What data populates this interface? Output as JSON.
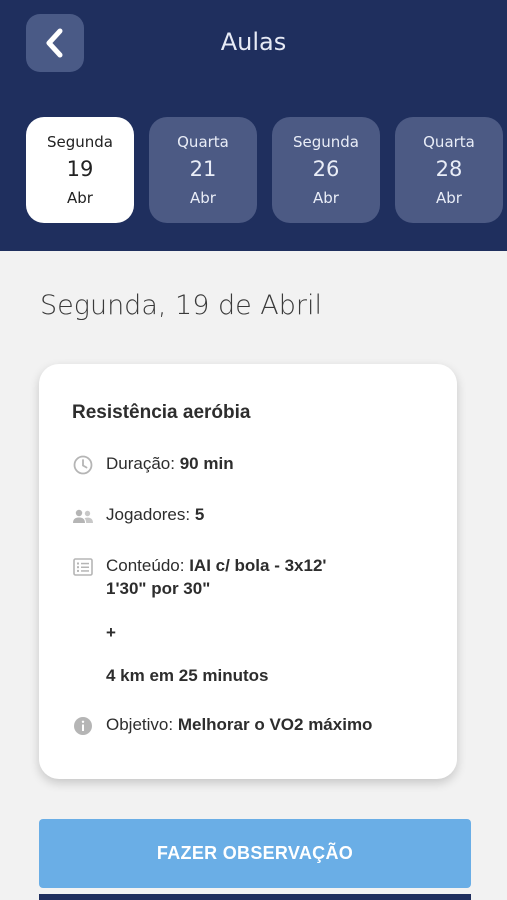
{
  "header": {
    "title": "Aulas"
  },
  "dates": [
    {
      "dow": "Segunda",
      "day": "19",
      "month": "Abr",
      "selected": true
    },
    {
      "dow": "Quarta",
      "day": "21",
      "month": "Abr",
      "selected": false
    },
    {
      "dow": "Segunda",
      "day": "26",
      "month": "Abr",
      "selected": false
    },
    {
      "dow": "Quarta",
      "day": "28",
      "month": "Abr",
      "selected": false
    }
  ],
  "selected_date_heading": "Segunda, 19 de Abril",
  "lesson": {
    "title": "Resistência aeróbia",
    "duration_label": "Duração:",
    "duration_value": "90 min",
    "players_label": "Jogadores:",
    "players_value": "5",
    "content_label": "Conteúdo:",
    "content_value_line1": "IAI c/ bola - 3x12'",
    "content_value_line2": "1'30\" por 30\"",
    "content_plus": "+",
    "content_extra": "4 km em 25 minutos",
    "objective_label": "Objetivo:",
    "objective_value": "Melhorar o VO2 máximo"
  },
  "buttons": {
    "observation": "FAZER OBSERVAÇÃO"
  },
  "icons": {
    "back": "chevron-left-icon",
    "duration": "clock-icon",
    "players": "people-icon",
    "content": "list-icon",
    "objective": "info-icon"
  },
  "colors": {
    "header_bg": "#1f2f5e",
    "date_card_bg": "#4c5a84",
    "button_bg": "#6aaee6"
  }
}
